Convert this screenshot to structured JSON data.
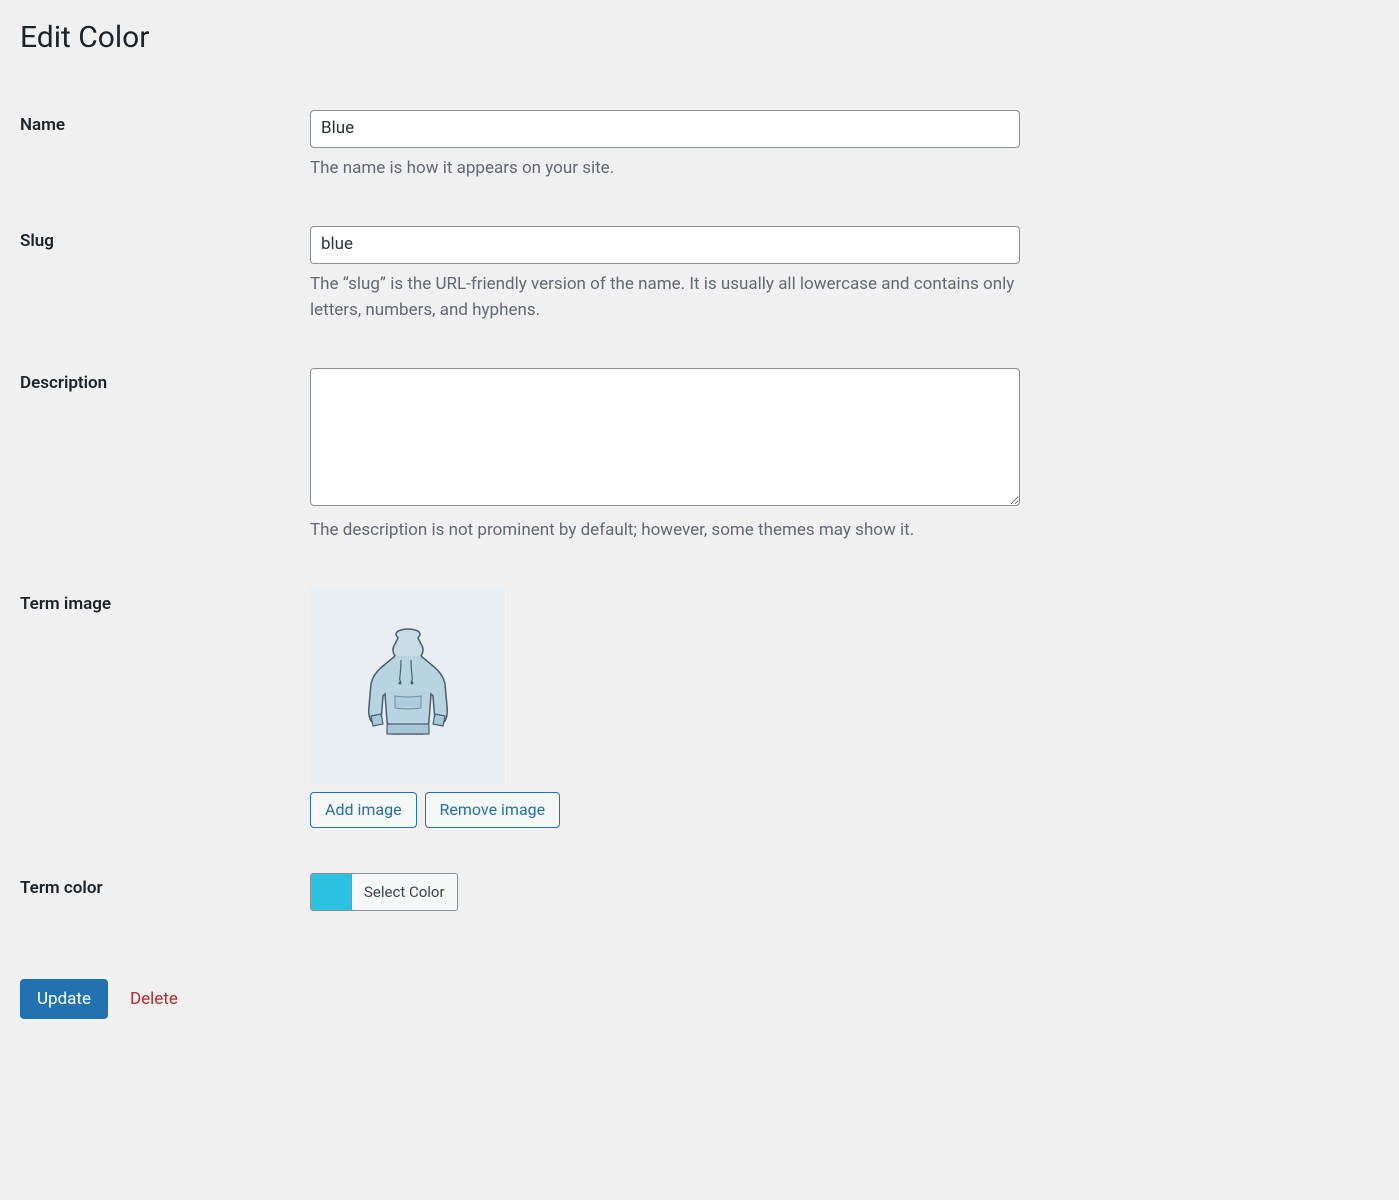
{
  "page": {
    "title": "Edit Color"
  },
  "fields": {
    "name": {
      "label": "Name",
      "value": "Blue",
      "description": "The name is how it appears on your site."
    },
    "slug": {
      "label": "Slug",
      "value": "blue",
      "description": "The “slug” is the URL-friendly version of the name. It is usually all lowercase and contains only letters, numbers, and hyphens."
    },
    "description": {
      "label": "Description",
      "value": "",
      "description": "The description is not prominent by default; however, some themes may show it."
    },
    "term_image": {
      "label": "Term image",
      "add_button": "Add image",
      "remove_button": "Remove image"
    },
    "term_color": {
      "label": "Term color",
      "swatch_color": "#2dc2e3",
      "button_label": "Select Color"
    }
  },
  "actions": {
    "update": "Update",
    "delete": "Delete"
  }
}
